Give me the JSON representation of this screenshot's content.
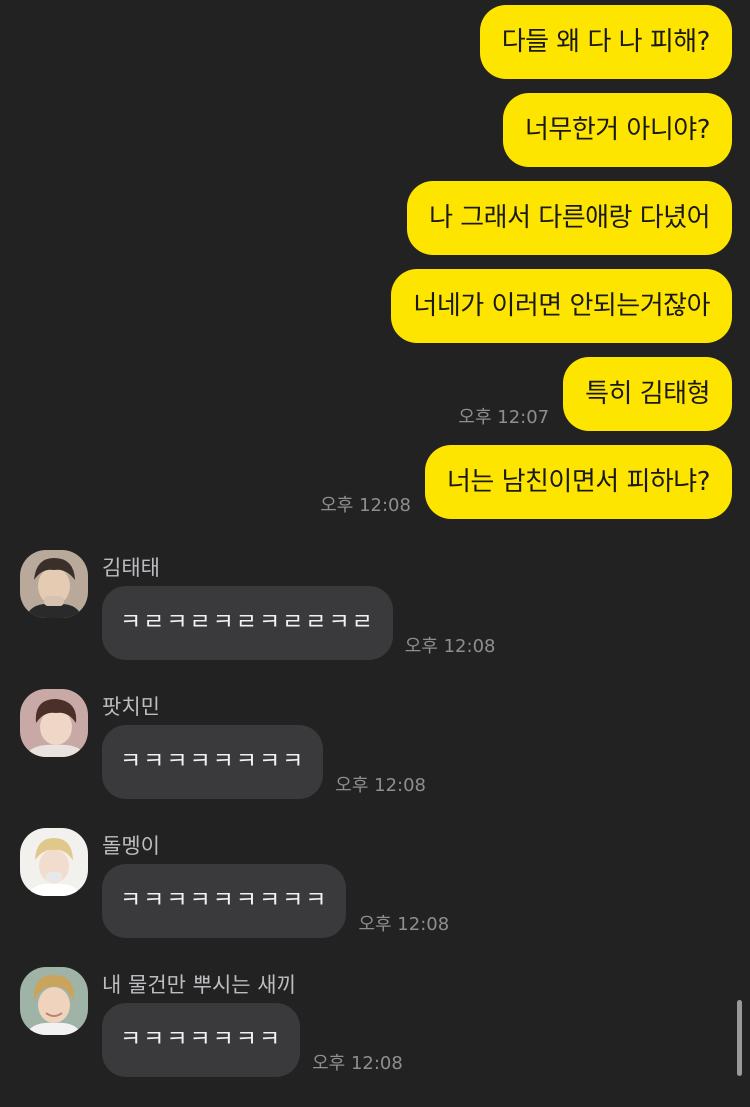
{
  "outgoing": [
    {
      "text": "다들 왜 다 나 피해?",
      "time": ""
    },
    {
      "text": "너무한거 아니야?",
      "time": ""
    },
    {
      "text": "나 그래서 다른애랑 다녔어",
      "time": ""
    },
    {
      "text": "너네가 이러면 안되는거잖아",
      "time": ""
    },
    {
      "text": "특히 김태형",
      "time": "오후 12:07"
    },
    {
      "text": "너는 남친이면서 피하냐?",
      "time": "오후 12:08"
    }
  ],
  "incoming": [
    {
      "sender": "김태태",
      "text": "ㅋㄹㅋㄹㅋㄹㅋㄹㄹㅋㄹ",
      "time": "오후 12:08",
      "avatar": "profile-photo"
    },
    {
      "sender": "팟치민",
      "text": "ㅋㅋㅋㅋㅋㅋㅋㅋ",
      "time": "오후 12:08",
      "avatar": "profile-photo"
    },
    {
      "sender": "돌멩이",
      "text": "ㅋㅋㅋㅋㅋㅋㅋㅋㅋ",
      "time": "오후 12:08",
      "avatar": "profile-photo"
    },
    {
      "sender": "내 물건만 뿌시는 새끼",
      "text": "ㅋㅋㅋㅋㅋㅋㅋ",
      "time": "오후 12:08",
      "avatar": "profile-photo"
    }
  ],
  "colors": {
    "background": "#222223",
    "outgoing_bubble": "#fee500",
    "incoming_bubble": "#3a3a3c",
    "timestamp": "#8e8e90"
  }
}
